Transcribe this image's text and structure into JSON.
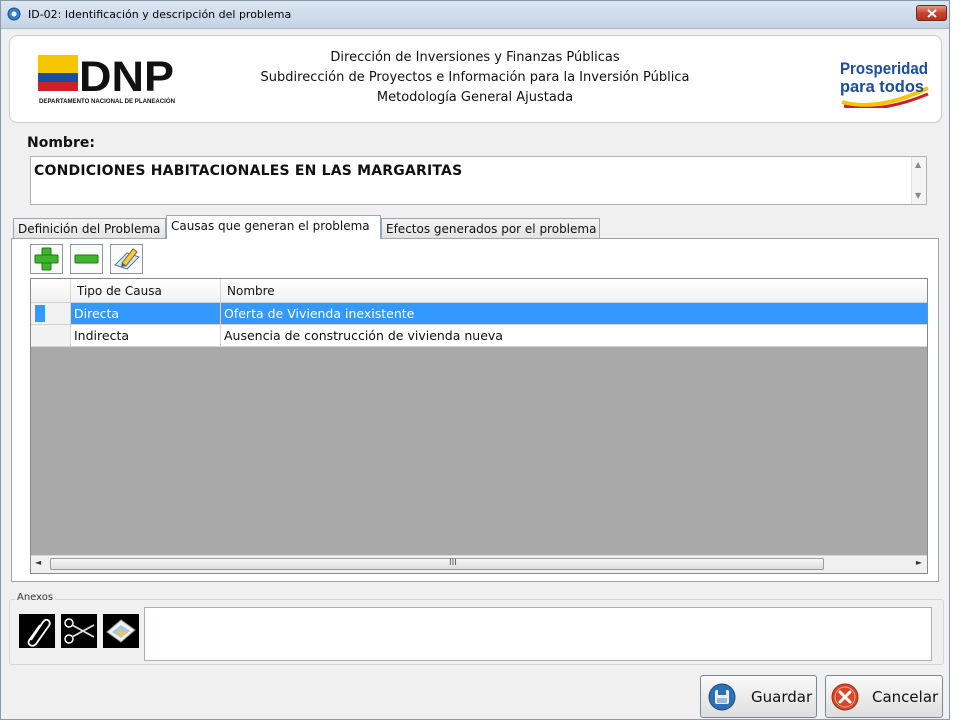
{
  "window": {
    "title": "ID-02: Identificación y descripción del problema"
  },
  "header": {
    "line1": "Dirección de Inversiones y Finanzas Públicas",
    "line2": "Subdirección de Proyectos e Información para la Inversión Pública",
    "line3": "Metodología General Ajustada",
    "logo_text": "DNP",
    "logo_subtext": "DEPARTAMENTO NACIONAL DE PLANEACIÓN",
    "brand_text_1": "Prosperidad",
    "brand_text_2": "para todos"
  },
  "nombre": {
    "label": "Nombre:",
    "value": "CONDICIONES HABITACIONALES EN LAS MARGARITAS"
  },
  "tabs": [
    {
      "label": "Definición del Problema",
      "active": false
    },
    {
      "label": "Causas que generan el problema",
      "active": true
    },
    {
      "label": "Efectos generados por el problema",
      "active": false
    }
  ],
  "toolbar": {
    "add_icon": "plus-icon",
    "remove_icon": "minus-icon",
    "edit_icon": "edit-icon"
  },
  "grid": {
    "columns": [
      "Tipo de Causa",
      "Nombre"
    ],
    "rows": [
      {
        "tipo": "Directa",
        "nombre": "Oferta de Vivienda inexistente",
        "selected": true
      },
      {
        "tipo": "Indirecta",
        "nombre": "Ausencia de  construcción  de vivienda  nueva",
        "selected": false
      }
    ],
    "scroll_grip": "III"
  },
  "anexos": {
    "label": "Anexos",
    "icons": [
      "paperclip-icon",
      "scissors-icon",
      "images-icon"
    ]
  },
  "buttons": {
    "save": "Guardar",
    "cancel": "Cancelar"
  },
  "colors": {
    "selection": "#3399ff",
    "flag_yellow": "#f4c600",
    "flag_blue": "#1b4d9c",
    "flag_red": "#d21f26"
  }
}
